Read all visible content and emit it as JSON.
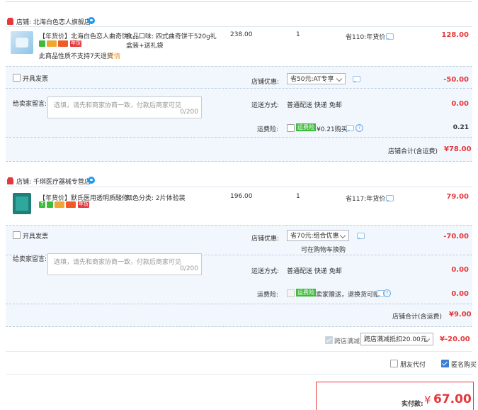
{
  "shops": [
    {
      "label": "店铺: 北海白色恋人旗舰店",
      "item": {
        "title": "【年货价】北海白色恋人曲奇饼...",
        "sku_line1": "食品口味: 四式曲奇饼干520g礼",
        "sku_line2": "盒装+送礼袋",
        "price": "238.00",
        "qty": "1",
        "saving": "省110:年货价",
        "total": "128.00",
        "note": "此商品性质不支持7天退货",
        "note_link": "详情",
        "tag_text": "年货"
      },
      "invoice_label": "开具发票",
      "message_label": "给卖家留言:",
      "message_placeholder": "选填，请先和商家协商一致，付款后商家可见",
      "message_count": "0/200",
      "discount_label": "店铺优惠:",
      "discount_value": "省50元:AT专享",
      "discount_amount": "-50.00",
      "shipping_label": "运送方式:",
      "shipping_value": "普通配送 快递 免邮",
      "shipping_amount": "0.00",
      "insurance_label": "运费险:",
      "insurance_tag": "运费险",
      "insurance_text": "¥0.21购买",
      "insurance_amount": "0.21",
      "subtotal_label": "店铺合计(含运费)",
      "subtotal_amount": "¥78.00"
    },
    {
      "label": "店铺: 千琪医疗器械专营店",
      "item": {
        "title": "【年货价】默氏医用透明质酸修...",
        "sku_line1": "颜色分类: 2片体验装",
        "price": "196.00",
        "qty": "1",
        "saving": "省117:年货价",
        "total": "79.00",
        "tag_text": "年货",
        "tag_num": "7"
      },
      "invoice_label": "开具发票",
      "message_label": "给卖家留言:",
      "message_placeholder": "选填，请先和商家协商一致，付款后商家可见",
      "message_count": "0/200",
      "discount_label": "店铺优惠:",
      "discount_value": "省70元:组合优惠",
      "discount_note": "可在购物车换购",
      "discount_amount": "-70.00",
      "shipping_label": "运送方式:",
      "shipping_value": "普通配送 快递 免邮",
      "shipping_amount": "0.00",
      "insurance_label": "运费险:",
      "insurance_tag": "运费险",
      "insurance_text": "卖家赠送，退换货可赔",
      "insurance_amount": "0.00",
      "subtotal_label": "店铺合计(含运费)",
      "subtotal_amount": "¥9.00"
    }
  ],
  "cross_store": {
    "label": "跨店满减",
    "select": "跨店满减抵扣20.00元",
    "amount": "¥-20.00"
  },
  "friend_pay": "朋友代付",
  "anonymous": "匿名购买",
  "final": {
    "label": "实付款:",
    "currency": "¥",
    "amount": "67.00"
  },
  "colors": {
    "accent_red": "#e4393c",
    "panel_bg": "#f2f7fd",
    "link_blue": "#1e9bf0",
    "insurance_green": "#3dbb3a"
  }
}
